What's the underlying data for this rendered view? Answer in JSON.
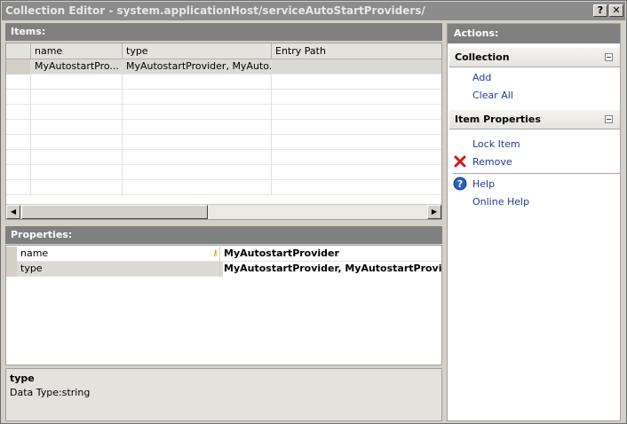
{
  "window": {
    "title": "Collection Editor - system.applicationHost/serviceAutoStartProviders/",
    "help_button": "?",
    "close_button": "✕"
  },
  "items": {
    "header": "Items:",
    "columns": [
      "name",
      "type",
      "Entry Path"
    ],
    "rows": [
      {
        "name": "MyAutostartPro...",
        "type": "MyAutostartProvider, MyAuto...",
        "entry_path": ""
      }
    ]
  },
  "properties": {
    "header": "Properties:",
    "rows": [
      {
        "name": "name",
        "value": "MyAutostartProvider"
      },
      {
        "name": "type",
        "value": "MyAutostartProvider, MyAutostartProvider,"
      }
    ]
  },
  "description": {
    "title": "type",
    "text": "Data Type:string"
  },
  "actions": {
    "header": "Actions:",
    "collection": {
      "title": "Collection",
      "links": [
        "Add",
        "Clear All"
      ]
    },
    "item_properties": {
      "title": "Item Properties",
      "lock_item": "Lock Item",
      "remove": "Remove",
      "help": "Help",
      "online_help": "Online Help"
    }
  },
  "icons": {
    "remove": "red-x-icon",
    "help": "help-circle-icon",
    "key": "key-icon"
  }
}
